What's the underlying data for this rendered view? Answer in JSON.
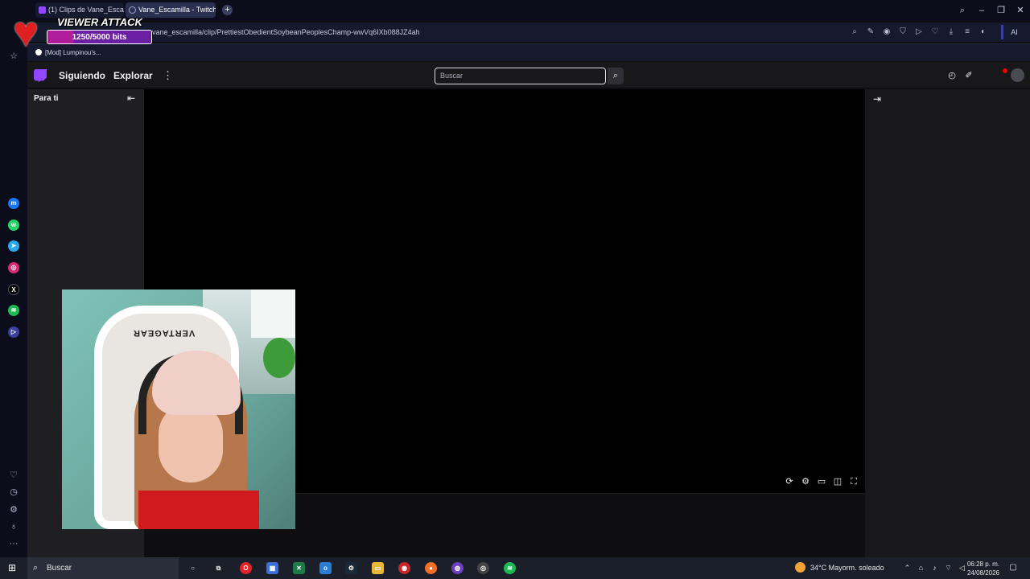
{
  "browser": {
    "tabs": [
      {
        "label": "(1) Clips de Vane_Escamilla"
      },
      {
        "label": "Vane_Escamilla - Twitch"
      }
    ],
    "new_tab_glyph": "+",
    "window_controls": {
      "search": "⌕",
      "minimize": "–",
      "restore": "❐",
      "close": "✕"
    },
    "url": "vane_escamilla/clip/PrettiestObedientSoybeanPeoplesChamp-wwVq6IXb088JZ4ah",
    "ai_button": "AI",
    "bookmark": "[Mod] Lumpinou's..."
  },
  "overlay": {
    "title": "VIEWER ATTACK",
    "bits": "1250/5000 bits",
    "progress": 0.25
  },
  "twitch": {
    "nav": {
      "following": "Siguiendo",
      "explore": "Explorar",
      "more": "⋮"
    },
    "search_placeholder": "Buscar",
    "sidebar_title": "Para ti"
  },
  "taskbar": {
    "search_placeholder": "Buscar",
    "weather": "34°C  Mayorm. soleado",
    "time": "06:28 p. m.",
    "date": "24/08/2026"
  },
  "colors": {
    "twitch_purple": "#9146ff",
    "browser_bg": "#0b0d1a",
    "overlay_bar": "#6b1fa3"
  },
  "icons": {
    "opera_sidebar": [
      "home-icon",
      "messenger-icon",
      "whatsapp-icon",
      "telegram-icon",
      "instagram-icon",
      "x-icon",
      "spotify-icon",
      "player-icon",
      "heart-icon",
      "history-icon",
      "settings-icon",
      "lightbulb-icon",
      "more-icon"
    ],
    "video_controls": [
      "refresh-icon",
      "settings-icon",
      "theatre-mode-icon",
      "sidebar-icon",
      "fullscreen-icon"
    ]
  }
}
